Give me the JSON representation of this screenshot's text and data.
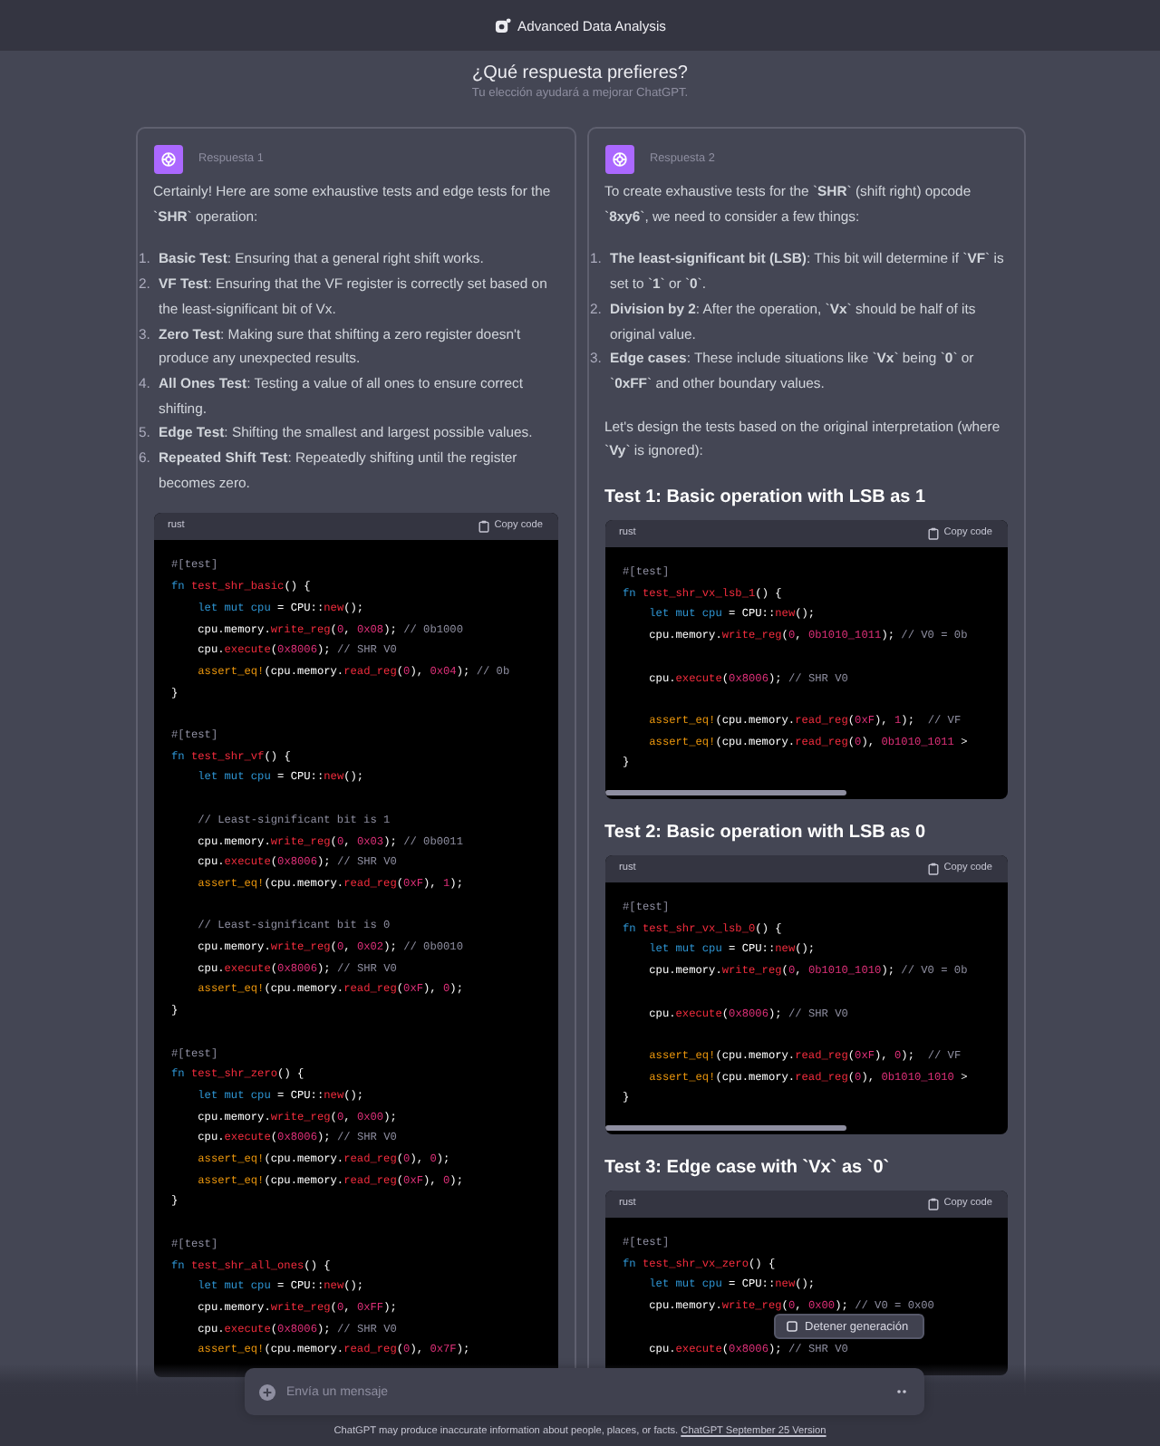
{
  "header": {
    "title": "Advanced Data Analysis"
  },
  "prompt": {
    "title": "¿Qué respuesta prefieres?",
    "subtitle": "Tu elección ayudará a mejorar ChatGPT."
  },
  "responses": [
    {
      "label": "Respuesta 1",
      "blocks": [
        {
          "kind": "paragraph",
          "text": "Certainly! Here are some exhaustive tests and edge tests for the `**SHR**` operation:"
        },
        {
          "kind": "list",
          "items": [
            {
              "number": "1.",
              "text": "**Basic Test**: Ensuring that a general right shift works."
            },
            {
              "number": "2.",
              "text": "**VF Test**: Ensuring that the VF register is correctly set based on the least-significant bit of Vx."
            },
            {
              "number": "3.",
              "text": "**Zero Test**: Making sure that shifting a zero register doesn't produce any unexpected results."
            },
            {
              "number": "4.",
              "text": "**All Ones Test**: Testing a value of all ones to ensure correct shifting."
            },
            {
              "number": "5.",
              "text": "**Edge Test**: Shifting the smallest and largest possible values."
            },
            {
              "number": "6.",
              "text": "**Repeated Shift Test**: Repeatedly shifting until the register becomes zero."
            }
          ]
        },
        {
          "kind": "code",
          "language": "rust",
          "copy_label": "Copy code",
          "scrollbar": false,
          "groups": [
            [
              [
                {
                  "text": "#[test]",
                  "kind": "comment"
                }
              ],
              [
                {
                  "text": "fn ",
                  "kind": "keyword"
                },
                {
                  "text": "test_shr_basic",
                  "kind": "function"
                },
                {
                  "text": "() {",
                  "kind": "plain"
                }
              ],
              [
                {
                  "text": "    let mut cpu",
                  "kind": "keyword"
                },
                {
                  "text": " = CPU::",
                  "kind": "plain"
                },
                {
                  "text": "new",
                  "kind": "function"
                },
                {
                  "text": "();",
                  "kind": "plain"
                }
              ],
              [
                {
                  "text": "    cpu.memory.",
                  "kind": "plain"
                },
                {
                  "text": "write_reg",
                  "kind": "function"
                },
                {
                  "text": "(",
                  "kind": "plain"
                },
                {
                  "text": "0",
                  "kind": "number"
                },
                {
                  "text": ", ",
                  "kind": "plain"
                },
                {
                  "text": "0x08",
                  "kind": "number"
                },
                {
                  "text": "); ",
                  "kind": "plain"
                },
                {
                  "text": "// 0b1000",
                  "kind": "comment"
                }
              ],
              [
                {
                  "text": "    cpu.",
                  "kind": "plain"
                },
                {
                  "text": "execute",
                  "kind": "function"
                },
                {
                  "text": "(",
                  "kind": "plain"
                },
                {
                  "text": "0x8006",
                  "kind": "number"
                },
                {
                  "text": "); ",
                  "kind": "plain"
                },
                {
                  "text": "// SHR V0",
                  "kind": "comment"
                }
              ],
              [
                {
                  "text": "    assert_eq!",
                  "kind": "macro"
                },
                {
                  "text": "(cpu.memory.",
                  "kind": "plain"
                },
                {
                  "text": "read_reg",
                  "kind": "function"
                },
                {
                  "text": "(",
                  "kind": "plain"
                },
                {
                  "text": "0",
                  "kind": "number"
                },
                {
                  "text": "), ",
                  "kind": "plain"
                },
                {
                  "text": "0x04",
                  "kind": "number"
                },
                {
                  "text": "); ",
                  "kind": "plain"
                },
                {
                  "text": "// 0b",
                  "kind": "comment"
                }
              ],
              [
                {
                  "text": "}",
                  "kind": "plain"
                }
              ]
            ],
            [
              [
                {
                  "text": "#[test]",
                  "kind": "comment"
                }
              ],
              [
                {
                  "text": "fn ",
                  "kind": "keyword"
                },
                {
                  "text": "test_shr_vf",
                  "kind": "function"
                },
                {
                  "text": "() {",
                  "kind": "plain"
                }
              ],
              [
                {
                  "text": "    let mut cpu",
                  "kind": "keyword"
                },
                {
                  "text": " = CPU::",
                  "kind": "plain"
                },
                {
                  "text": "new",
                  "kind": "function"
                },
                {
                  "text": "();",
                  "kind": "plain"
                }
              ]
            ],
            [
              [
                {
                  "text": "    // Least-significant bit is 1",
                  "kind": "comment"
                }
              ],
              [
                {
                  "text": "    cpu.memory.",
                  "kind": "plain"
                },
                {
                  "text": "write_reg",
                  "kind": "function"
                },
                {
                  "text": "(",
                  "kind": "plain"
                },
                {
                  "text": "0",
                  "kind": "number"
                },
                {
                  "text": ", ",
                  "kind": "plain"
                },
                {
                  "text": "0x03",
                  "kind": "number"
                },
                {
                  "text": "); ",
                  "kind": "plain"
                },
                {
                  "text": "// 0b0011",
                  "kind": "comment"
                }
              ],
              [
                {
                  "text": "    cpu.",
                  "kind": "plain"
                },
                {
                  "text": "execute",
                  "kind": "function"
                },
                {
                  "text": "(",
                  "kind": "plain"
                },
                {
                  "text": "0x8006",
                  "kind": "number"
                },
                {
                  "text": "); ",
                  "kind": "plain"
                },
                {
                  "text": "// SHR V0",
                  "kind": "comment"
                }
              ],
              [
                {
                  "text": "    assert_eq!",
                  "kind": "macro"
                },
                {
                  "text": "(cpu.memory.",
                  "kind": "plain"
                },
                {
                  "text": "read_reg",
                  "kind": "function"
                },
                {
                  "text": "(",
                  "kind": "plain"
                },
                {
                  "text": "0xF",
                  "kind": "number"
                },
                {
                  "text": "), ",
                  "kind": "plain"
                },
                {
                  "text": "1",
                  "kind": "number"
                },
                {
                  "text": ");",
                  "kind": "plain"
                }
              ]
            ],
            [
              [
                {
                  "text": "    // Least-significant bit is 0",
                  "kind": "comment"
                }
              ],
              [
                {
                  "text": "    cpu.memory.",
                  "kind": "plain"
                },
                {
                  "text": "write_reg",
                  "kind": "function"
                },
                {
                  "text": "(",
                  "kind": "plain"
                },
                {
                  "text": "0",
                  "kind": "number"
                },
                {
                  "text": ", ",
                  "kind": "plain"
                },
                {
                  "text": "0x02",
                  "kind": "number"
                },
                {
                  "text": "); ",
                  "kind": "plain"
                },
                {
                  "text": "// 0b0010",
                  "kind": "comment"
                }
              ],
              [
                {
                  "text": "    cpu.",
                  "kind": "plain"
                },
                {
                  "text": "execute",
                  "kind": "function"
                },
                {
                  "text": "(",
                  "kind": "plain"
                },
                {
                  "text": "0x8006",
                  "kind": "number"
                },
                {
                  "text": "); ",
                  "kind": "plain"
                },
                {
                  "text": "// SHR V0",
                  "kind": "comment"
                }
              ],
              [
                {
                  "text": "    assert_eq!",
                  "kind": "macro"
                },
                {
                  "text": "(cpu.memory.",
                  "kind": "plain"
                },
                {
                  "text": "read_reg",
                  "kind": "function"
                },
                {
                  "text": "(",
                  "kind": "plain"
                },
                {
                  "text": "0xF",
                  "kind": "number"
                },
                {
                  "text": "), ",
                  "kind": "plain"
                },
                {
                  "text": "0",
                  "kind": "number"
                },
                {
                  "text": ");",
                  "kind": "plain"
                }
              ],
              [
                {
                  "text": "}",
                  "kind": "plain"
                }
              ]
            ],
            [
              [
                {
                  "text": "#[test]",
                  "kind": "comment"
                }
              ],
              [
                {
                  "text": "fn ",
                  "kind": "keyword"
                },
                {
                  "text": "test_shr_zero",
                  "kind": "function"
                },
                {
                  "text": "() {",
                  "kind": "plain"
                }
              ],
              [
                {
                  "text": "    let mut cpu",
                  "kind": "keyword"
                },
                {
                  "text": " = CPU::",
                  "kind": "plain"
                },
                {
                  "text": "new",
                  "kind": "function"
                },
                {
                  "text": "();",
                  "kind": "plain"
                }
              ],
              [
                {
                  "text": "    cpu.memory.",
                  "kind": "plain"
                },
                {
                  "text": "write_reg",
                  "kind": "function"
                },
                {
                  "text": "(",
                  "kind": "plain"
                },
                {
                  "text": "0",
                  "kind": "number"
                },
                {
                  "text": ", ",
                  "kind": "plain"
                },
                {
                  "text": "0x00",
                  "kind": "number"
                },
                {
                  "text": ");",
                  "kind": "plain"
                }
              ],
              [
                {
                  "text": "    cpu.",
                  "kind": "plain"
                },
                {
                  "text": "execute",
                  "kind": "function"
                },
                {
                  "text": "(",
                  "kind": "plain"
                },
                {
                  "text": "0x8006",
                  "kind": "number"
                },
                {
                  "text": "); ",
                  "kind": "plain"
                },
                {
                  "text": "// SHR V0",
                  "kind": "comment"
                }
              ],
              [
                {
                  "text": "    assert_eq!",
                  "kind": "macro"
                },
                {
                  "text": "(cpu.memory.",
                  "kind": "plain"
                },
                {
                  "text": "read_reg",
                  "kind": "function"
                },
                {
                  "text": "(",
                  "kind": "plain"
                },
                {
                  "text": "0",
                  "kind": "number"
                },
                {
                  "text": "), ",
                  "kind": "plain"
                },
                {
                  "text": "0",
                  "kind": "number"
                },
                {
                  "text": ");",
                  "kind": "plain"
                }
              ],
              [
                {
                  "text": "    assert_eq!",
                  "kind": "macro"
                },
                {
                  "text": "(cpu.memory.",
                  "kind": "plain"
                },
                {
                  "text": "read_reg",
                  "kind": "function"
                },
                {
                  "text": "(",
                  "kind": "plain"
                },
                {
                  "text": "0xF",
                  "kind": "number"
                },
                {
                  "text": "), ",
                  "kind": "plain"
                },
                {
                  "text": "0",
                  "kind": "number"
                },
                {
                  "text": ");",
                  "kind": "plain"
                }
              ],
              [
                {
                  "text": "}",
                  "kind": "plain"
                }
              ]
            ],
            [
              [
                {
                  "text": "#[test]",
                  "kind": "comment"
                }
              ],
              [
                {
                  "text": "fn ",
                  "kind": "keyword"
                },
                {
                  "text": "test_shr_all_ones",
                  "kind": "function"
                },
                {
                  "text": "() {",
                  "kind": "plain"
                }
              ],
              [
                {
                  "text": "    let mut cpu",
                  "kind": "keyword"
                },
                {
                  "text": " = CPU::",
                  "kind": "plain"
                },
                {
                  "text": "new",
                  "kind": "function"
                },
                {
                  "text": "();",
                  "kind": "plain"
                }
              ],
              [
                {
                  "text": "    cpu.memory.",
                  "kind": "plain"
                },
                {
                  "text": "write_reg",
                  "kind": "function"
                },
                {
                  "text": "(",
                  "kind": "plain"
                },
                {
                  "text": "0",
                  "kind": "number"
                },
                {
                  "text": ", ",
                  "kind": "plain"
                },
                {
                  "text": "0xFF",
                  "kind": "number"
                },
                {
                  "text": ");",
                  "kind": "plain"
                }
              ],
              [
                {
                  "text": "    cpu.",
                  "kind": "plain"
                },
                {
                  "text": "execute",
                  "kind": "function"
                },
                {
                  "text": "(",
                  "kind": "plain"
                },
                {
                  "text": "0x8006",
                  "kind": "number"
                },
                {
                  "text": "); ",
                  "kind": "plain"
                },
                {
                  "text": "// SHR V0",
                  "kind": "comment"
                }
              ],
              [
                {
                  "text": "    assert_eq!",
                  "kind": "macro"
                },
                {
                  "text": "(cpu.memory.",
                  "kind": "plain"
                },
                {
                  "text": "read_reg",
                  "kind": "function"
                },
                {
                  "text": "(",
                  "kind": "plain"
                },
                {
                  "text": "0",
                  "kind": "number"
                },
                {
                  "text": "), ",
                  "kind": "plain"
                },
                {
                  "text": "0x7F",
                  "kind": "number"
                },
                {
                  "text": ");",
                  "kind": "plain"
                }
              ]
            ]
          ]
        }
      ]
    },
    {
      "label": "Respuesta 2",
      "blocks": [
        {
          "kind": "paragraph",
          "text": "To create exhaustive tests for the `**SHR**` (shift right) opcode `**8xy6**`, we need to consider a few things:"
        },
        {
          "kind": "list",
          "items": [
            {
              "number": "1.",
              "text": "**The least-significant bit (LSB)**: This bit will determine if `**VF**` is set to `**1**` or `**0**`."
            },
            {
              "number": "2.",
              "text": "**Division by 2**: After the operation, `**Vx**` should be half of its original value."
            },
            {
              "number": "3.",
              "text": "**Edge cases**: These include situations like `**Vx**` being `**0**` or `**0xFF**` and other boundary values."
            }
          ]
        },
        {
          "kind": "paragraph",
          "text": "Let's design the tests based on the original interpretation (where `**Vy**` is ignored):"
        },
        {
          "kind": "heading",
          "text": "Test 1: Basic operation with LSB as 1"
        },
        {
          "kind": "code",
          "language": "rust",
          "copy_label": "Copy code",
          "scrollbar": true,
          "groups": [
            [
              [
                {
                  "text": "#[test]",
                  "kind": "comment"
                }
              ],
              [
                {
                  "text": "fn ",
                  "kind": "keyword"
                },
                {
                  "text": "test_shr_vx_lsb_1",
                  "kind": "function"
                },
                {
                  "text": "() {",
                  "kind": "plain"
                }
              ],
              [
                {
                  "text": "    let mut cpu",
                  "kind": "keyword"
                },
                {
                  "text": " = CPU::",
                  "kind": "plain"
                },
                {
                  "text": "new",
                  "kind": "function"
                },
                {
                  "text": "();",
                  "kind": "plain"
                }
              ],
              [
                {
                  "text": "    cpu.memory.",
                  "kind": "plain"
                },
                {
                  "text": "write_reg",
                  "kind": "function"
                },
                {
                  "text": "(",
                  "kind": "plain"
                },
                {
                  "text": "0",
                  "kind": "number"
                },
                {
                  "text": ", ",
                  "kind": "plain"
                },
                {
                  "text": "0b1010_1011",
                  "kind": "number"
                },
                {
                  "text": "); ",
                  "kind": "plain"
                },
                {
                  "text": "// V0 = 0b",
                  "kind": "comment"
                }
              ]
            ],
            [
              [
                {
                  "text": "    cpu.",
                  "kind": "plain"
                },
                {
                  "text": "execute",
                  "kind": "function"
                },
                {
                  "text": "(",
                  "kind": "plain"
                },
                {
                  "text": "0x8006",
                  "kind": "number"
                },
                {
                  "text": "); ",
                  "kind": "plain"
                },
                {
                  "text": "// SHR V0",
                  "kind": "comment"
                }
              ]
            ],
            [
              [
                {
                  "text": "    assert_eq!",
                  "kind": "macro"
                },
                {
                  "text": "(cpu.memory.",
                  "kind": "plain"
                },
                {
                  "text": "read_reg",
                  "kind": "function"
                },
                {
                  "text": "(",
                  "kind": "plain"
                },
                {
                  "text": "0xF",
                  "kind": "number"
                },
                {
                  "text": "), ",
                  "kind": "plain"
                },
                {
                  "text": "1",
                  "kind": "number"
                },
                {
                  "text": ");  ",
                  "kind": "plain"
                },
                {
                  "text": "// VF",
                  "kind": "comment"
                }
              ],
              [
                {
                  "text": "    assert_eq!",
                  "kind": "macro"
                },
                {
                  "text": "(cpu.memory.",
                  "kind": "plain"
                },
                {
                  "text": "read_reg",
                  "kind": "function"
                },
                {
                  "text": "(",
                  "kind": "plain"
                },
                {
                  "text": "0",
                  "kind": "number"
                },
                {
                  "text": "), ",
                  "kind": "plain"
                },
                {
                  "text": "0b1010_1011",
                  "kind": "number"
                },
                {
                  "text": " >",
                  "kind": "plain"
                }
              ],
              [
                {
                  "text": "}",
                  "kind": "plain"
                }
              ]
            ]
          ]
        },
        {
          "kind": "heading",
          "text": "Test 2: Basic operation with LSB as 0"
        },
        {
          "kind": "code",
          "language": "rust",
          "copy_label": "Copy code",
          "scrollbar": true,
          "groups": [
            [
              [
                {
                  "text": "#[test]",
                  "kind": "comment"
                }
              ],
              [
                {
                  "text": "fn ",
                  "kind": "keyword"
                },
                {
                  "text": "test_shr_vx_lsb_0",
                  "kind": "function"
                },
                {
                  "text": "() {",
                  "kind": "plain"
                }
              ],
              [
                {
                  "text": "    let mut cpu",
                  "kind": "keyword"
                },
                {
                  "text": " = CPU::",
                  "kind": "plain"
                },
                {
                  "text": "new",
                  "kind": "function"
                },
                {
                  "text": "();",
                  "kind": "plain"
                }
              ],
              [
                {
                  "text": "    cpu.memory.",
                  "kind": "plain"
                },
                {
                  "text": "write_reg",
                  "kind": "function"
                },
                {
                  "text": "(",
                  "kind": "plain"
                },
                {
                  "text": "0",
                  "kind": "number"
                },
                {
                  "text": ", ",
                  "kind": "plain"
                },
                {
                  "text": "0b1010_1010",
                  "kind": "number"
                },
                {
                  "text": "); ",
                  "kind": "plain"
                },
                {
                  "text": "// V0 = 0b",
                  "kind": "comment"
                }
              ]
            ],
            [
              [
                {
                  "text": "    cpu.",
                  "kind": "plain"
                },
                {
                  "text": "execute",
                  "kind": "function"
                },
                {
                  "text": "(",
                  "kind": "plain"
                },
                {
                  "text": "0x8006",
                  "kind": "number"
                },
                {
                  "text": "); ",
                  "kind": "plain"
                },
                {
                  "text": "// SHR V0",
                  "kind": "comment"
                }
              ]
            ],
            [
              [
                {
                  "text": "    assert_eq!",
                  "kind": "macro"
                },
                {
                  "text": "(cpu.memory.",
                  "kind": "plain"
                },
                {
                  "text": "read_reg",
                  "kind": "function"
                },
                {
                  "text": "(",
                  "kind": "plain"
                },
                {
                  "text": "0xF",
                  "kind": "number"
                },
                {
                  "text": "), ",
                  "kind": "plain"
                },
                {
                  "text": "0",
                  "kind": "number"
                },
                {
                  "text": ");  ",
                  "kind": "plain"
                },
                {
                  "text": "// VF",
                  "kind": "comment"
                }
              ],
              [
                {
                  "text": "    assert_eq!",
                  "kind": "macro"
                },
                {
                  "text": "(cpu.memory.",
                  "kind": "plain"
                },
                {
                  "text": "read_reg",
                  "kind": "function"
                },
                {
                  "text": "(",
                  "kind": "plain"
                },
                {
                  "text": "0",
                  "kind": "number"
                },
                {
                  "text": "), ",
                  "kind": "plain"
                },
                {
                  "text": "0b1010_1010",
                  "kind": "number"
                },
                {
                  "text": " >",
                  "kind": "plain"
                }
              ],
              [
                {
                  "text": "}",
                  "kind": "plain"
                }
              ]
            ]
          ]
        },
        {
          "kind": "heading",
          "text": "Test 3: Edge case with `Vx` as `0`"
        },
        {
          "kind": "code",
          "language": "rust",
          "copy_label": "Copy code",
          "scrollbar": false,
          "groups": [
            [
              [
                {
                  "text": "#[test]",
                  "kind": "comment"
                }
              ],
              [
                {
                  "text": "fn ",
                  "kind": "keyword"
                },
                {
                  "text": "test_shr_vx_zero",
                  "kind": "function"
                },
                {
                  "text": "() {",
                  "kind": "plain"
                }
              ],
              [
                {
                  "text": "    let mut cpu",
                  "kind": "keyword"
                },
                {
                  "text": " = CPU::",
                  "kind": "plain"
                },
                {
                  "text": "new",
                  "kind": "function"
                },
                {
                  "text": "();",
                  "kind": "plain"
                }
              ],
              [
                {
                  "text": "    cpu.memory.",
                  "kind": "plain"
                },
                {
                  "text": "write_reg",
                  "kind": "function"
                },
                {
                  "text": "(",
                  "kind": "plain"
                },
                {
                  "text": "0",
                  "kind": "number"
                },
                {
                  "text": ", ",
                  "kind": "plain"
                },
                {
                  "text": "0x00",
                  "kind": "number"
                },
                {
                  "text": "); ",
                  "kind": "plain"
                },
                {
                  "text": "// V0 = 0x00",
                  "kind": "comment"
                }
              ]
            ],
            [
              [
                {
                  "text": "    cpu.",
                  "kind": "plain"
                },
                {
                  "text": "execute",
                  "kind": "function"
                },
                {
                  "text": "(",
                  "kind": "plain"
                },
                {
                  "text": "0x8006",
                  "kind": "number"
                },
                {
                  "text": "); ",
                  "kind": "plain"
                },
                {
                  "text": "// SHR V0",
                  "kind": "comment"
                }
              ]
            ]
          ]
        }
      ]
    }
  ],
  "stop_button": {
    "label": "Detener generación"
  },
  "composer": {
    "placeholder": "Envía un mensaje"
  },
  "footer": {
    "text": "ChatGPT may produce inaccurate information about people, places, or facts.",
    "link": "ChatGPT September 25 Version"
  }
}
